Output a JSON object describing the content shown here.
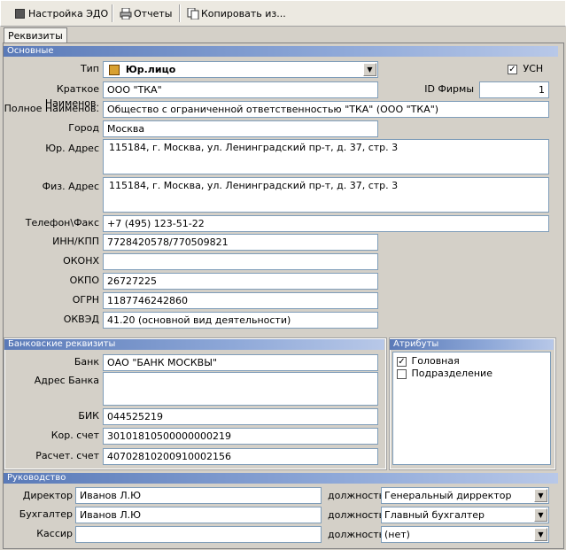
{
  "toolbar": {
    "edo_label": "Настройка ЭДО",
    "reports_label": "Отчеты",
    "copy_label": "Копировать из..."
  },
  "tabs": {
    "requisites": "Реквизиты"
  },
  "main": {
    "section_title": "Основные",
    "type_label": "Тип",
    "type_value": "Юр.лицо",
    "usn_label": "УСН",
    "usn_checked": true,
    "short_name_label": "Краткое Наименов.",
    "short_name_value": "ООО \"ТКА\"",
    "firm_id_label": "ID Фирмы",
    "firm_id_value": "1",
    "full_name_label": "Полное Наименов.",
    "full_name_value": "Общество с ограниченной ответственностью \"ТКА\" (ООО \"ТКА\")",
    "city_label": "Город",
    "city_value": "Москва",
    "legal_address_label": "Юр. Адрес",
    "legal_address_value": "115184, г. Москва, ул. Ленинградский пр-т, д. 37, стр. 3",
    "phys_address_label": "Физ. Адрес",
    "phys_address_value": "115184, г. Москва, ул. Ленинградский пр-т, д. 37, стр. 3",
    "phone_label": "Телефон\\Факс",
    "phone_value": "+7 (495) 123-51-22",
    "inn_label": "ИНН/КПП",
    "inn_value": "7728420578/770509821",
    "okonh_label": "ОКОНХ",
    "okonh_value": "",
    "okpo_label": "ОКПО",
    "okpo_value": "26727225",
    "ogrn_label": "ОГРН",
    "ogrn_value": "1187746242860",
    "okved_label": "ОКВЭД",
    "okved_value": "41.20 (основной вид деятельности)"
  },
  "bank": {
    "section_title": "Банковские реквизиты",
    "bank_label": "Банк",
    "bank_value": "ОАО  \"БАНК МОСКВЫ\"",
    "bank_address_label": "Адрес Банка",
    "bank_address_value": "",
    "bik_label": "БИК",
    "bik_value": "044525219",
    "corr_label": "Кор. счет",
    "corr_value": "30101810500000000219",
    "account_label": "Расчет. счет",
    "account_value": "40702810200910002156"
  },
  "attributes": {
    "section_title": "Атрибуты",
    "items": [
      {
        "label": "Головная",
        "checked": true
      },
      {
        "label": "Подразделение",
        "checked": false
      }
    ]
  },
  "management": {
    "section_title": "Руководство",
    "position_label": "должность",
    "rows": [
      {
        "role": "Директор",
        "name": "Иванов Л.Ю",
        "position": "Генеральный дирректор"
      },
      {
        "role": "Бухгалтер",
        "name": "Иванов Л.Ю",
        "position": "Главный бухгалтер"
      },
      {
        "role": "Кассир",
        "name": "",
        "position": "(нет)"
      }
    ]
  }
}
